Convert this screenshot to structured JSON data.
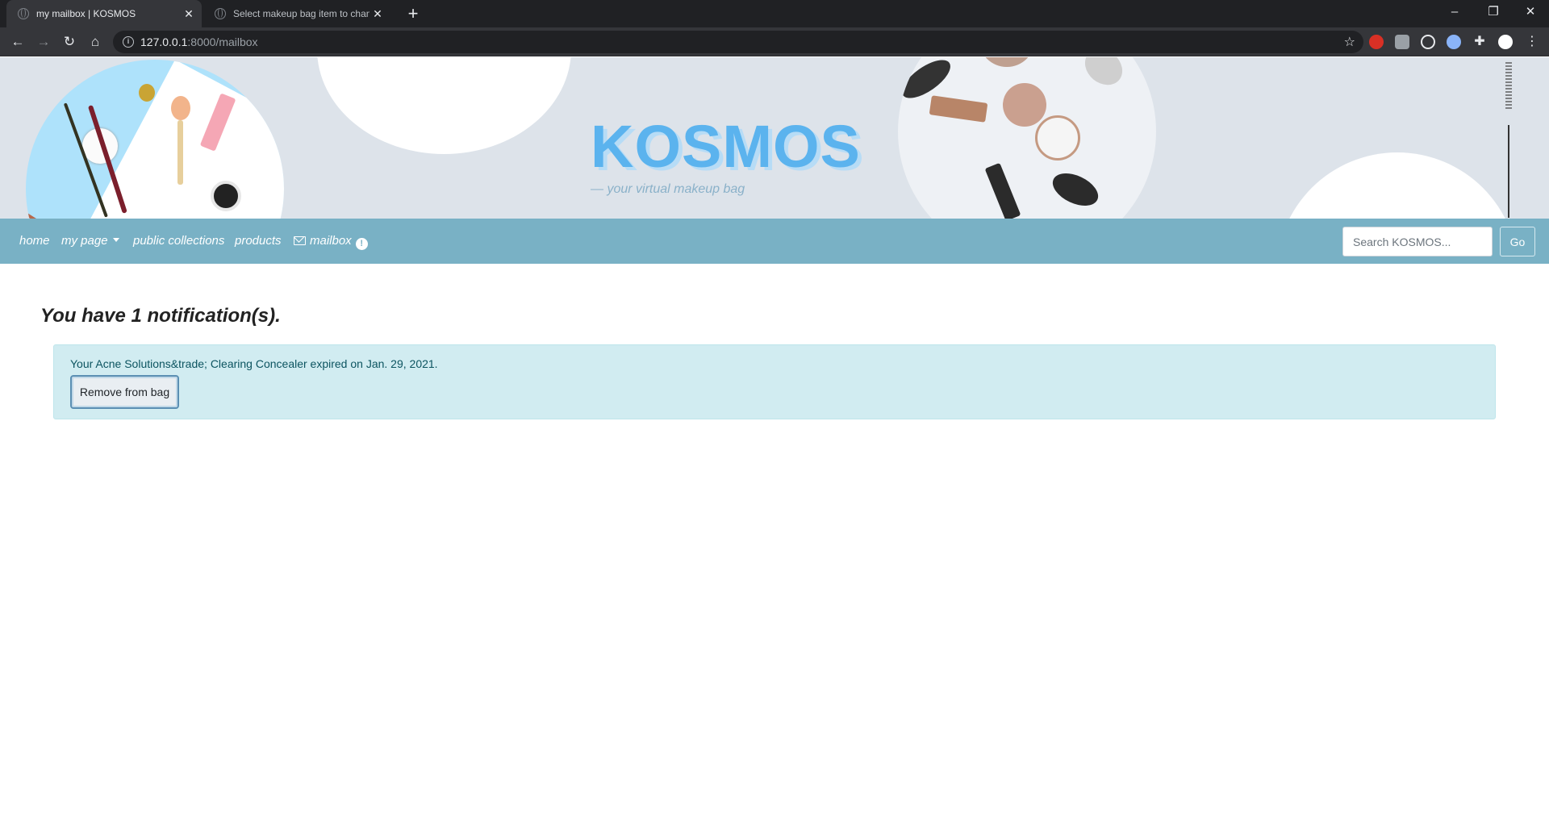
{
  "browser": {
    "tabs": [
      {
        "title": "my mailbox | KOSMOS",
        "active": true
      },
      {
        "title": "Select makeup bag item to chan",
        "active": false
      }
    ],
    "url_host": "127.0.0.1",
    "url_path": ":8000/mailbox"
  },
  "banner": {
    "logo": "KOSMOS",
    "tagline": "— your virtual makeup bag"
  },
  "nav": {
    "home": "home",
    "my_page": "my page",
    "public_collections": "public collections",
    "products": "products",
    "mailbox": "mailbox",
    "alert_glyph": "!",
    "search_placeholder": "Search KOSMOS...",
    "go": "Go"
  },
  "main": {
    "heading": "You have 1 notification(s).",
    "notification_text": "Your Acne Solutions&trade; Clearing Concealer expired on Jan. 29, 2021.",
    "remove_button": "Remove from bag"
  },
  "colors": {
    "nav_bg": "#79b1c5",
    "banner_bg": "#dde3ea",
    "logo": "#5bb3ee",
    "notice_bg": "#d1ecf1",
    "notice_text": "#0c5460"
  }
}
